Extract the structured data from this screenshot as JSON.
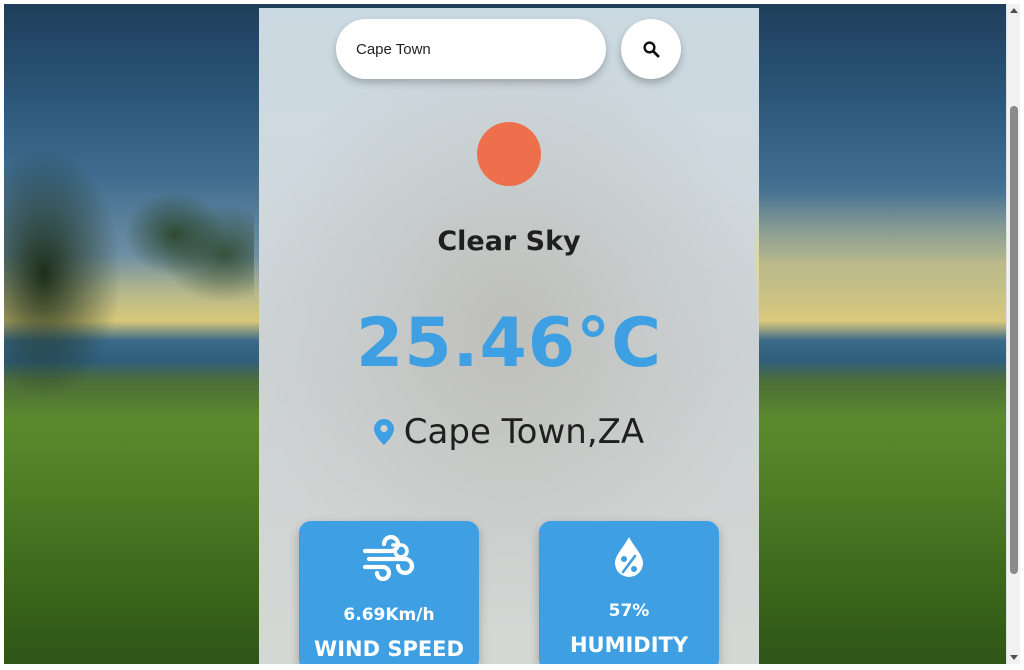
{
  "search": {
    "value": "Cape Town",
    "button_icon": "search-icon"
  },
  "weather": {
    "condition": "Clear Sky",
    "temperature": "25.46°C",
    "location": "Cape Town,ZA",
    "icon": "sun-icon",
    "sun_color": "#ee6f4c"
  },
  "wind": {
    "value": "6.69Km/h",
    "label": "WIND SPEED",
    "icon": "wind-icon"
  },
  "humidity": {
    "value": "57%",
    "label": "HUMIDITY",
    "icon": "humidity-drop-icon"
  },
  "colors": {
    "accent": "#3ea0e3",
    "text": "#1f1f1f"
  }
}
